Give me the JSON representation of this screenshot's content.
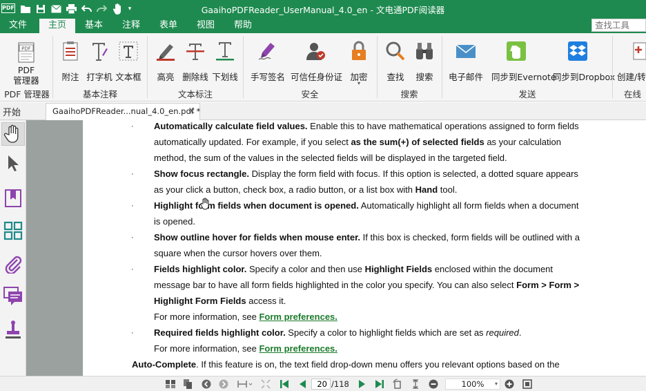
{
  "window": {
    "logo_text": "PDF",
    "title": "GaaihoPDFReader_UserManual_4.0_en - 文电通PDF阅读器"
  },
  "menu": {
    "tabs": [
      {
        "label": "文件"
      },
      {
        "label": "主页"
      },
      {
        "label": "基本"
      },
      {
        "label": "注释"
      },
      {
        "label": "表单"
      },
      {
        "label": "视图"
      },
      {
        "label": "帮助"
      }
    ],
    "active_tab": "主页",
    "search_placeholder": "查找工具"
  },
  "ribbon": {
    "buttons": {
      "pdf_manager": "PDF\n管理器",
      "note": "附注",
      "typewriter": "打字机",
      "textbox": "文本框",
      "highlight": "高亮",
      "strikeout": "删除线",
      "underline": "下划线",
      "sign": "手写签名",
      "trusted_id": "可信任身份证",
      "encrypt": "加密",
      "find": "查找",
      "search": "搜索",
      "email": "电子邮件",
      "evernote": "同步到Evernote",
      "dropbox": "同步到Dropbox",
      "create_convert": "创建/转"
    },
    "groups": {
      "pdf_manager": "PDF 管理器",
      "basic_annot": "基本注释",
      "text_markup": "文本标注",
      "security": "安全",
      "search": "搜索",
      "send": "发送",
      "online": "在线"
    }
  },
  "tabs": {
    "start": "开始",
    "document": "GaaihoPDFReader...nual_4.0_en.pdf *",
    "close": "✕"
  },
  "document": {
    "lines": [
      {
        "b": "Automatically calculate field values.",
        "t": " Enable this to have mathematical operations assigned to form fields"
      },
      {
        "t": "automatically updated. For example, if you select ",
        "b2": "as the sum(+) of selected fields",
        "t2": " as your calculation"
      },
      {
        "t": "method, the sum of the values in the selected fields will be displayed in the targeted field."
      },
      {
        "b": "Show focus rectangle.",
        "t": " Display the form field with focus. If this option is selected, a dotted square appears"
      },
      {
        "t": "as your click a button, check box, a radio button, or a list box with ",
        "b2": "Hand",
        "t2": " tool."
      },
      {
        "b": "Highlight form fields when document is opened.",
        "t": " Automatically highlight all form fields when a document"
      },
      {
        "t": "is opened."
      },
      {
        "b": "Show outline hover for fields when mouse enter.",
        "t": " If this box is checked, form fields will be outlined with a"
      },
      {
        "t": "square when the cursor hovers over them."
      },
      {
        "b": "Fields highlight color.",
        "t": " Specify a color and then use ",
        "b2": "Highlight Fields",
        "t2": " enclosed within the document"
      },
      {
        "t": "message bar to have all form fields highlighted in the color you specify. You can also select ",
        "b2": "Form > Form >"
      },
      {
        "b": "Highlight Form Fields",
        "t": " access it."
      },
      {
        "t": "For more information, see ",
        "link": "Form preferences."
      },
      {
        "b": "Required fields highlight color.",
        "t": " Specify a color to highlight fields which are set as ",
        "i": "required",
        "t2": "."
      },
      {
        "t": "For more information, see ",
        "link": "Form preferences."
      },
      {
        "b": "Auto-Complete",
        "t": ". If this feature is on, the text field drop-down menu offers you relevant options based on the"
      }
    ],
    "bullet": "·"
  },
  "status": {
    "current_page": "20",
    "total_pages": "/118",
    "zoom": "100%"
  },
  "colors": {
    "brand_green": "#1e8a4f",
    "link_green": "#1a7a2a",
    "ribbon_bg": "#f5f5f5"
  }
}
